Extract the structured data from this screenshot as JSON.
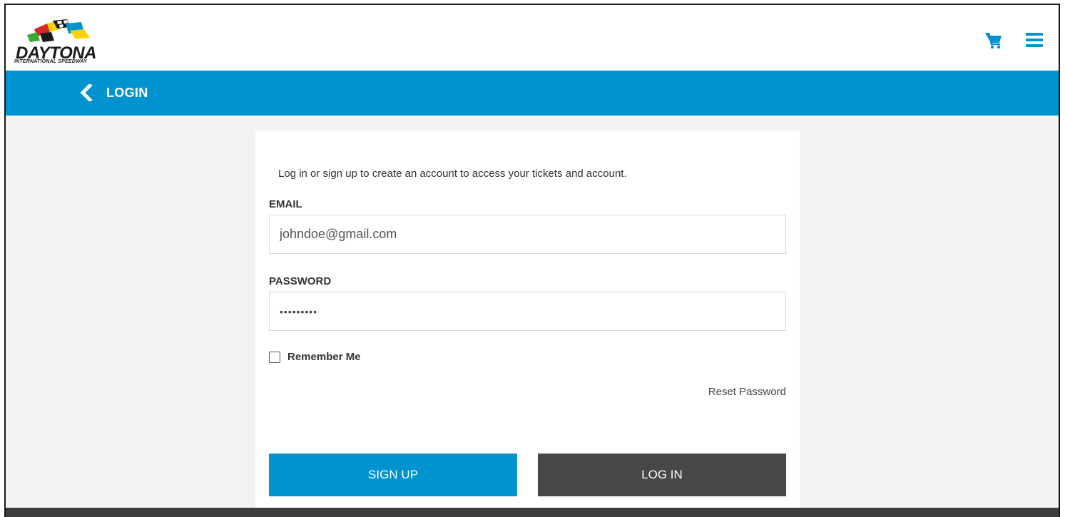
{
  "brand": {
    "logo_text": "DAYTONA",
    "logo_subtext": "INTERNATIONAL SPEEDWAY",
    "accent_color": "#0093d0",
    "dark_color": "#474747"
  },
  "header": {
    "cart_icon": "shopping-cart-icon",
    "menu_icon": "hamburger-menu-icon"
  },
  "subbar": {
    "back_icon": "chevron-left-icon",
    "title": "LOGIN"
  },
  "form": {
    "intro": "Log in or sign up to create an account to access your tickets and account.",
    "email_label": "EMAIL",
    "email_value": "johndoe@gmail.com",
    "password_label": "PASSWORD",
    "password_value": "•••••••••",
    "remember_label": "Remember Me",
    "remember_checked": false,
    "reset_link": "Reset Password",
    "signup_label": "SIGN UP",
    "login_label": "LOG IN"
  }
}
